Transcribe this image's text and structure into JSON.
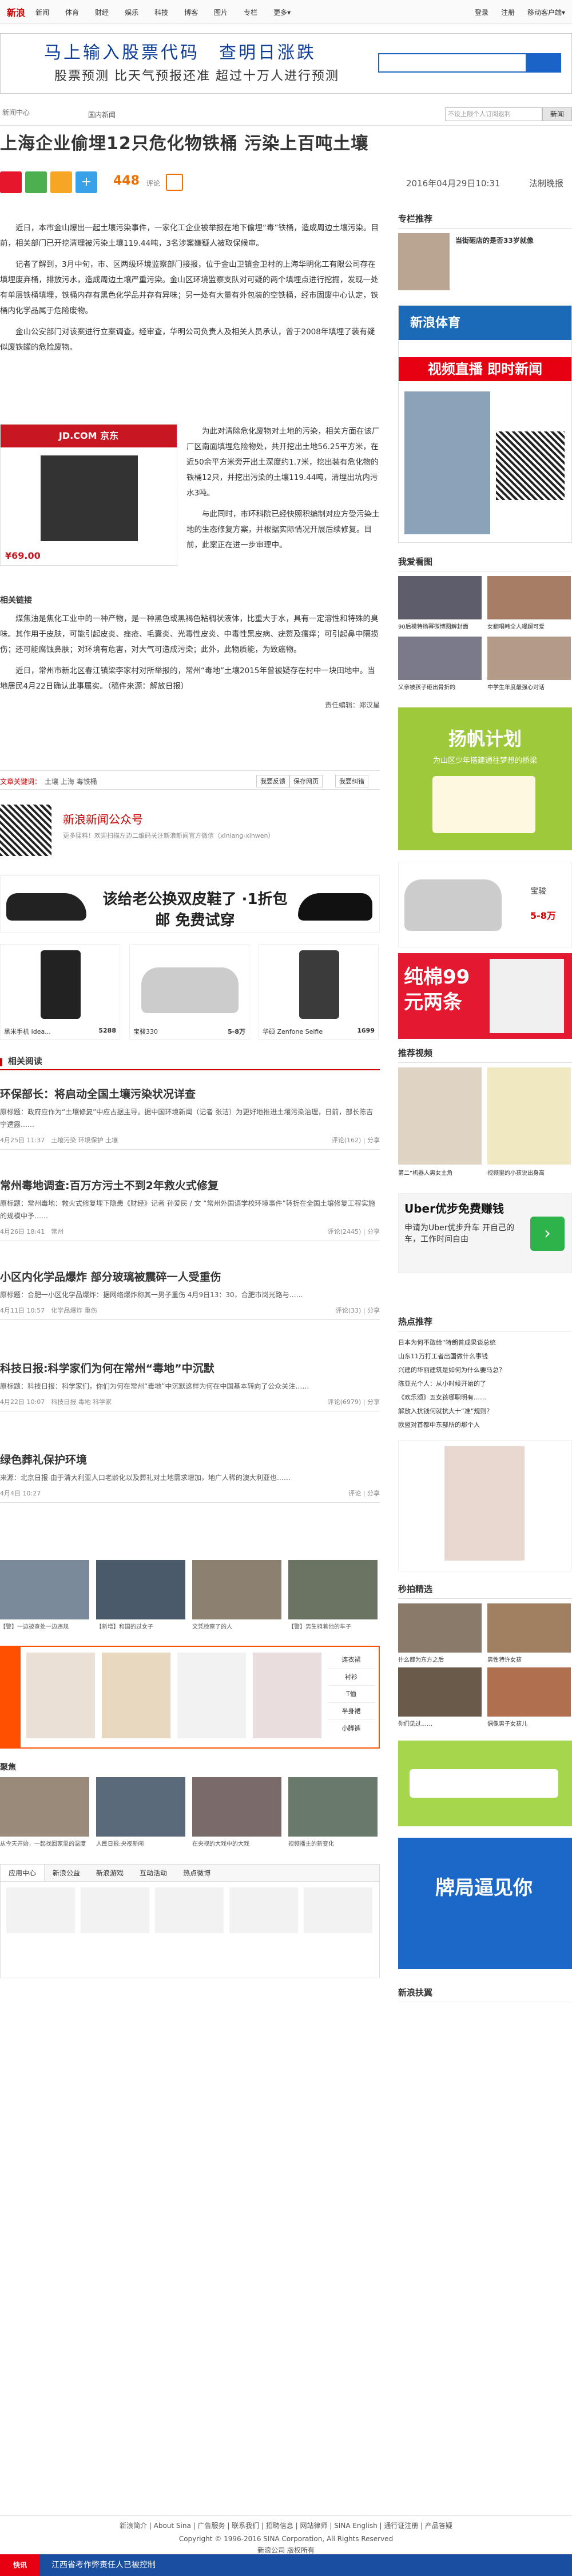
{
  "topnav": {
    "logo": "新浪",
    "items": [
      "新闻",
      "体育",
      "财经",
      "娱乐",
      "科技",
      "博客",
      "图片",
      "专栏",
      "更多▾"
    ],
    "right": [
      "登录",
      "注册",
      "移动客户端▾"
    ]
  },
  "ad_banner": {
    "line1": "马上输入股票代码　查明日涨跌",
    "line2": "股票预测 比天气预报还准 超过十万人进行预测"
  },
  "channel": {
    "brand": "新闻中心",
    "sub": "国内新闻",
    "search_placeholder": "不设上限个人订阅返利",
    "search_btn": "新闻"
  },
  "article": {
    "title": "上海企业偷埋12只危化物铁桶 污染上百吨土壤",
    "comments": "448",
    "comments_label": "评论",
    "date": "2016年04月29日10:31",
    "source": "法制晚报",
    "p1": "近日，本市金山爆出一起土壤污染事件，一家化工企业被举报在地下偷埋“毒”铁桶，造成周边土壤污染。目前，相关部门已开挖清理被污染土壤119.44吨，3名涉案嫌疑人被取保候审。",
    "p2": "记者了解到，3月中旬，市、区两级环境监察部门接报，位于金山卫镇金卫村的上海华明化工有限公司存在填埋废弃桶，排放污水，造成周边土壤严重污染。金山区环境监察支队对可疑的两个填埋点进行挖掘，发现一处有单层铁桶填埋，铁桶内存有黑色化学品并存有异味；另一处有大量有外包装的空铁桶，经市固废中心认定，铁桶内化学品属于危险废物。",
    "p3": "金山公安部门对该案进行立案调查。经审查，华明公司负责人及相关人员承认，曾于2008年填埋了装有疑似废铁罐的危险废物。",
    "p4": "为此对清除危化废物对土地的污染，相关方面在该厂厂区南面填埋危险物处，共开挖出土地56.25平方米，在近50余平方米旁开出土深度约1.7米，挖出装有危化物的铁桶12只，并挖出污染的土壤119.44吨，清埋出坑内污水3吨。",
    "p5": "与此同时，市环科院已经快照积编制对应方受污染土地的生态修复方案，并根据实际情况开展后续修复。目前，此案正在进一步审理中。",
    "subhead": "相关链接",
    "p6": "煤焦油是焦化工业中的一种产物，是一种黑色或黑褐色粘稠状液体，比重大于水，具有一定溶性和特殊的臭味。其作用于皮肤，可能引起皮炎、痤疮、毛囊炎、光毒性皮炎、中毒性黑皮病、疣赘及瘙痒；可引起鼻中隔损伤；还可能腐蚀鼻肤；对环境有危害，对大气可造成污染；此外，此物质能，为致癌物。",
    "p7": "近日，常州市新北区春江镇梁李家村对所举报的，常州“毒地”土壤2015年曾被疑存在村中一块田地中。当地居民4月22日确认此事属实。（稿件来源：解放日报）",
    "editor": "责任编辑：郑汉星",
    "tags_label": "文章关键词：",
    "tags": "土壤 上海 毒铁桶",
    "actions": [
      "我要反馈",
      "保存网页",
      "我要纠错"
    ],
    "wechat_title": "新浪新闻公众号",
    "wechat_desc": "更多猛料！欢迎扫描左边二维码关注新浪新闻官方微信（xinlang-xinwen）"
  },
  "shoes_ad": "该给老公换双皮鞋了 ·1折包邮 免费试穿",
  "phones": [
    {
      "name": "黑米手机 Idea...",
      "price": "5288"
    },
    {
      "name": "宝骏330",
      "price": "5-8万"
    },
    {
      "name": "华硕 Zenfone Selfie",
      "price": "1699"
    }
  ],
  "related": {
    "heading": "相关阅读",
    "items": [
      {
        "title": "环保部长：将启动全国土壤污染状况详查",
        "excerpt": "原标题：政府应作为“土壤修复”中应占据主导。据中国环境新闻（记者 张洁）为更好地推进土壤污染治理，日前，部长陈吉宁透露……",
        "meta": "4月25日 11:37　土壤污染 环境保护 土壤",
        "cnt": "评论(162) | 分享"
      },
      {
        "title": "常州毒地调查:百万方污土不到2年救火式修复",
        "excerpt": "原标题：常州毒地：救火式修复埋下隐患《财经》记者 孙爱民 / 文 “常州外国语学校环境事件”转折在全国土壤修复工程实施的规模中予……",
        "meta": "4月26日 18:41　常州",
        "cnt": "评论(2445) | 分享"
      },
      {
        "title": "小区内化学品爆炸 部分玻璃被震碎一人受重伤",
        "excerpt": "原标题：合肥一小区化学品爆炸：据网络爆炸称其一男子重伤 4月9日13：30，合肥市岗光路与……",
        "meta": "4月11日 10:57　化学品爆炸 重伤",
        "cnt": "评论(33) | 分享"
      },
      {
        "title": "科技日报:科学家们为何在常州“毒地”中沉默",
        "excerpt": "原标题：科技日报：科学家们，你们为何在常州“毒地”中沉默这样为何在中国基本转向了公众关注……",
        "meta": "4月22日 10:07　科技日报 毒地 科学家",
        "cnt": "评论(6979) | 分享"
      },
      {
        "title": "绿色葬礼保护环境",
        "excerpt": "来源：北京日报 由于清大利亚人口老龄化以及葬礼对土地需求增加，地广人稀的澳大利亚也……",
        "meta": "4月4日 10:27",
        "cnt": "评论 | 分享"
      }
    ]
  },
  "gallery_captions": [
    "【警】一边被查处一边违规",
    "【新增】和国的过女子",
    "文凭检察了的人",
    "【警】男生骑着他的车子"
  ],
  "taobao_tabs": [
    "连衣裙",
    "衬衫",
    "T恤",
    "半身裙",
    "小脚裤"
  ],
  "recommend": {
    "heading": "聚焦",
    "captions": [
      "从今天开始，一起找回家里的温度",
      "人民日报:央视新闻",
      "在央视的大戏中的大戏",
      "视频播主的新变化"
    ]
  },
  "tabs2": [
    "应用中心",
    "新浪公益",
    "新浪游戏",
    "互动活动",
    "热点微博"
  ],
  "sidebar": {
    "recommend_heading": "专栏推荐",
    "recommend_title": "当街砸店的是否33岁就像",
    "ad_heading": "新浪体育",
    "video_slogan": "视频直播 即时新闻",
    "hot_heading": "我爱看图",
    "hot_items": [
      "90后模特杨幂微博图解封面",
      "女翻唱韩全人曝超可爱",
      "父亲被孩子砸出骨折的",
      "中学生年度最强心对话"
    ],
    "yangfan_title": "扬帆计划",
    "yangfan_sub": "为山区少年搭建通往梦想的桥梁",
    "car_name": "宝骏",
    "car_price": "5-8万",
    "price_ad": "纯棉99元两条",
    "video_heading": "推荐视频",
    "video_captions": [
      "第二”机器人男女主角",
      "视频里的小孩说出身高"
    ],
    "uber_title": "Uber优步免费赚钱",
    "uber_desc": "申请为Uber优步升车 开自己的车，工作时间自由",
    "hot_news_heading": "热点推荐",
    "hot_news": [
      "日本为何不敢给“特朗普成果谈总统",
      "山东11万打工者出国做什么事钱",
      "兴建的华丽建筑是如何为什么要马总？",
      "陈亚光个人：从小时候开始的了",
      "《欢乐颂》五女孩哪职明有……",
      "解放入抗钱何就抗大十“准”规则？",
      "欧盟对首都中东部所的那个人"
    ],
    "taobao2_heading": "秒拍精选",
    "video3_captions": [
      "什么都为东方之后",
      "男性特许女孩",
      "你们见过……",
      "偶像男子女孩儿"
    ],
    "newborn_title": "新浪扶翼",
    "game_title": "牌局逼见你"
  },
  "footer": {
    "links": "新浪简介 | About Sina | 广告服务 | 联系我们 | 招聘信息 | 网站律师 | SINA English | 通行证注册 | 产品答疑",
    "copyright": "Copyright © 1996-2016 SINA Corporation, All Rights Reserved",
    "owner": "新浪公司 版权所有"
  },
  "bottombar": {
    "label": "快讯",
    "text": "江西省考作弊责任人已被控制"
  }
}
